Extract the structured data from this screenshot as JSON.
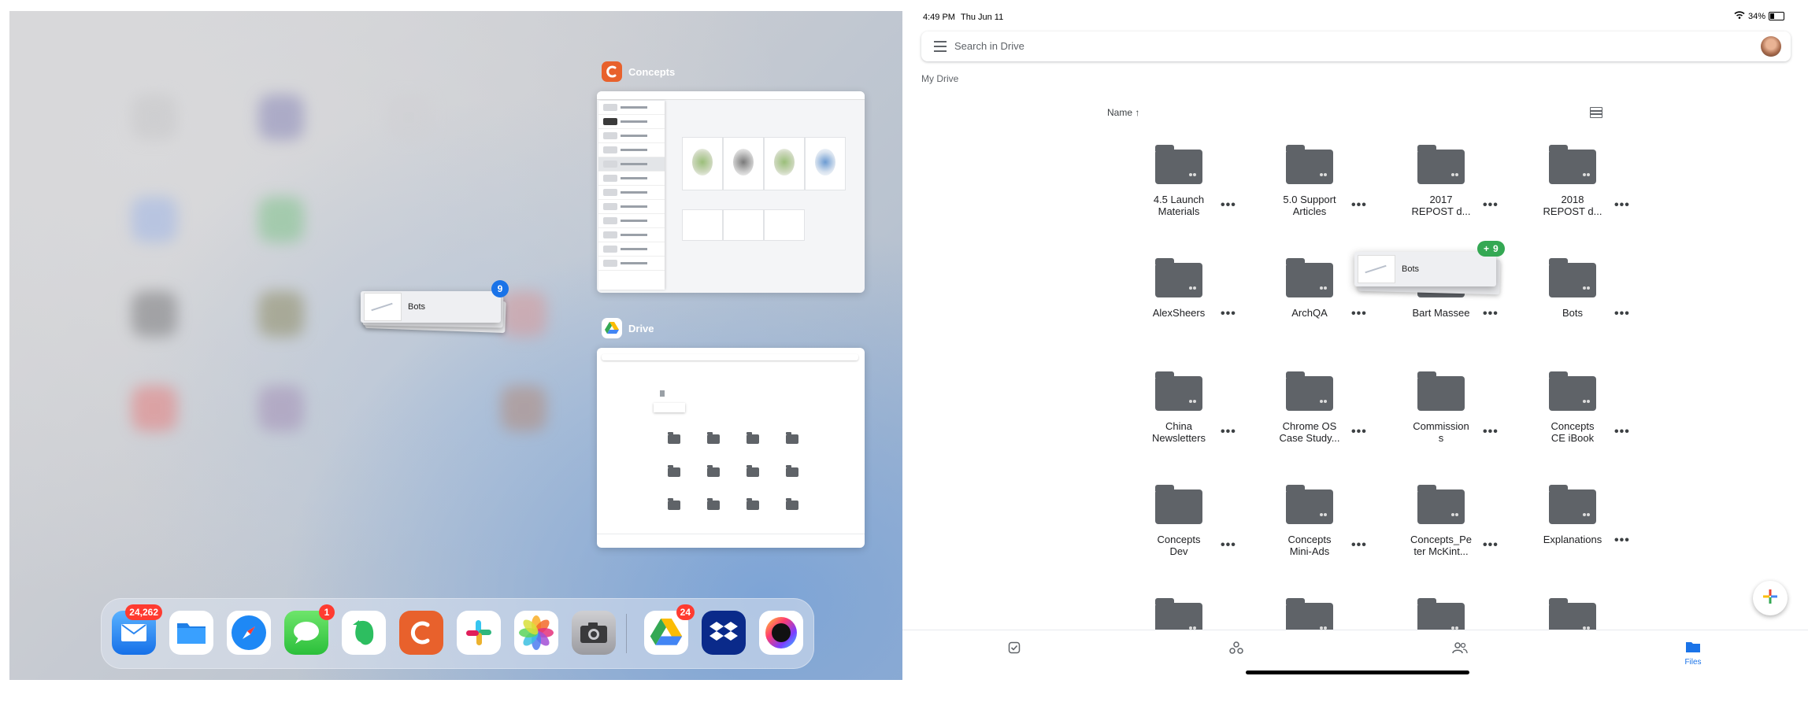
{
  "switcher": {
    "cards": [
      {
        "app": "Concepts"
      },
      {
        "app": "Drive"
      }
    ],
    "drag_item": {
      "label": "Bots",
      "count": "9"
    },
    "dock": {
      "apps": [
        {
          "name": "mail-app",
          "badge": "24,262"
        },
        {
          "name": "files-app",
          "badge": ""
        },
        {
          "name": "safari-app",
          "badge": ""
        },
        {
          "name": "messages-app",
          "badge": "1"
        },
        {
          "name": "evernote-app",
          "badge": ""
        },
        {
          "name": "concepts-app",
          "badge": ""
        },
        {
          "name": "slack-app",
          "badge": ""
        },
        {
          "name": "photos-app",
          "badge": ""
        },
        {
          "name": "camera-app",
          "badge": ""
        },
        {
          "name": "google-drive-app",
          "badge": "24"
        },
        {
          "name": "dropbox-app",
          "badge": ""
        },
        {
          "name": "procreate-app",
          "badge": ""
        }
      ]
    }
  },
  "drive": {
    "status": {
      "time": "4:49 PM",
      "date": "Thu Jun 11",
      "battery": "34%"
    },
    "search": {
      "placeholder": "Search in Drive"
    },
    "breadcrumb": "My Drive",
    "sort": {
      "label": "Name",
      "arrow": "↑"
    },
    "folders": [
      {
        "name": "4.5 Launch Materials",
        "lines": [
          "4.5 Launch",
          "Materials"
        ],
        "shared": true
      },
      {
        "name": "5.0 Support Articles",
        "lines": [
          "5.0 Support",
          "Articles"
        ],
        "shared": true
      },
      {
        "name": "2017 REPOST d...",
        "lines": [
          "2017",
          "REPOST d..."
        ],
        "shared": true
      },
      {
        "name": "2018 REPOST d...",
        "lines": [
          "2018",
          "REPOST d..."
        ],
        "shared": true
      },
      {
        "name": "AlexSheers",
        "lines": [
          "AlexSheers"
        ],
        "shared": true
      },
      {
        "name": "ArchQA",
        "lines": [
          "ArchQA"
        ],
        "shared": true
      },
      {
        "name": "Bart Massee",
        "lines": [
          "Bart Massee"
        ],
        "shared": true
      },
      {
        "name": "Bots",
        "lines": [
          "Bots"
        ],
        "shared": true
      },
      {
        "name": "China Newsletters",
        "lines": [
          "China",
          "Newsletters"
        ],
        "shared": true
      },
      {
        "name": "Chrome OS Case Study...",
        "lines": [
          "Chrome OS",
          "Case Study..."
        ],
        "shared": true
      },
      {
        "name": "Commissions",
        "lines": [
          "Commission",
          "s"
        ],
        "shared": false
      },
      {
        "name": "Concepts CE iBook",
        "lines": [
          "Concepts",
          "CE iBook"
        ],
        "shared": true
      },
      {
        "name": "Concepts Dev",
        "lines": [
          "Concepts",
          "Dev"
        ],
        "shared": false
      },
      {
        "name": "Concepts Mini-Ads",
        "lines": [
          "Concepts",
          "Mini-Ads"
        ],
        "shared": true
      },
      {
        "name": "Concepts_Peter McKint...",
        "lines": [
          "Concepts_Pe",
          "ter McKint..."
        ],
        "shared": true
      },
      {
        "name": "Explanations",
        "lines": [
          "Explanations"
        ],
        "shared": true
      },
      {
        "name": "",
        "lines": [],
        "shared": true
      },
      {
        "name": "",
        "lines": [],
        "shared": true
      },
      {
        "name": "",
        "lines": [],
        "shared": true
      },
      {
        "name": "",
        "lines": [],
        "shared": true
      }
    ],
    "drag_item": {
      "label": "Bots",
      "count": "9",
      "plus": "+"
    },
    "fab": {
      "icon": "plus-icon"
    },
    "bottom_nav": [
      {
        "icon": "priority-icon",
        "label": ""
      },
      {
        "icon": "workspaces-icon",
        "label": ""
      },
      {
        "icon": "shared-icon",
        "label": ""
      },
      {
        "icon": "folder-icon",
        "label": "Files"
      }
    ],
    "colors": {
      "accent": "#1a73e8",
      "folder": "#5f6368",
      "drag_badge_green": "#34a853",
      "drag_badge_blue": "#1a73e8"
    }
  }
}
